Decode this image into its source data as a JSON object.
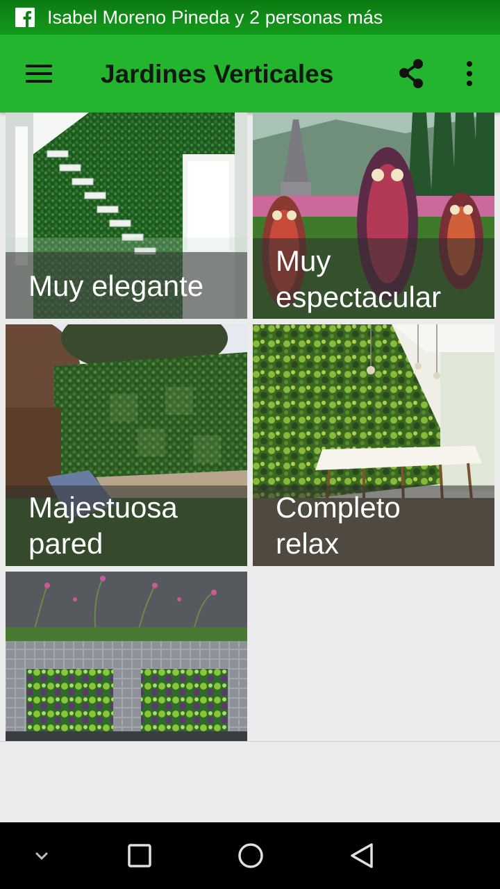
{
  "status_bar": {
    "notification_icon": "facebook-icon",
    "notification_text": "Isabel Moreno Pineda y 2 personas más"
  },
  "app_bar": {
    "title": "Jardines Verticales",
    "menu_icon": "hamburger-menu-icon",
    "share_icon": "share-icon",
    "more_icon": "more-vert-icon",
    "background": "#23b52d"
  },
  "gallery": {
    "items": [
      {
        "label": "Muy elegante"
      },
      {
        "label": "Muy\nespectacular"
      },
      {
        "label": "Majestuosa\npared"
      },
      {
        "label": "Completo\nrelax"
      },
      {
        "label": ""
      }
    ]
  },
  "nav_bar": {
    "buttons": [
      "chevron-down-icon",
      "recents-square-icon",
      "home-circle-icon",
      "back-triangle-icon"
    ]
  }
}
